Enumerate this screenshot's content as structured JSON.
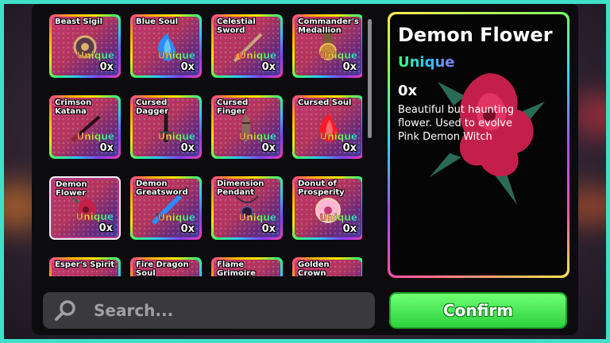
{
  "inventory": {
    "items": [
      {
        "name": "Beast Sigil",
        "rarity": "Unique",
        "qty": "0x",
        "icon": "beast-sigil-icon"
      },
      {
        "name": "Blue Soul",
        "rarity": "Unique",
        "qty": "0x",
        "icon": "blue-soul-icon"
      },
      {
        "name": "Celestial\nSword",
        "rarity": "Unique",
        "qty": "0x",
        "icon": "celestial-sword-icon"
      },
      {
        "name": "Commander's\nMedallion",
        "rarity": "Unique",
        "qty": "0x",
        "icon": "medallion-icon"
      },
      {
        "name": "Crimson\nKatana",
        "rarity": "Unique",
        "qty": "0x",
        "icon": "katana-icon"
      },
      {
        "name": "Cursed\nDagger",
        "rarity": "Unique",
        "qty": "0x",
        "icon": "dagger-icon"
      },
      {
        "name": "Cursed\nFinger",
        "rarity": "Unique",
        "qty": "0x",
        "icon": "finger-icon"
      },
      {
        "name": "Cursed Soul",
        "rarity": "Unique",
        "qty": "0x",
        "icon": "red-soul-icon"
      },
      {
        "name": "Demon\nFlower",
        "rarity": "Unique",
        "qty": "0x",
        "icon": "demon-flower-icon"
      },
      {
        "name": "Demon\nGreatsword",
        "rarity": "Unique",
        "qty": "0x",
        "icon": "greatsword-icon"
      },
      {
        "name": "Dimension\nPendant",
        "rarity": "Unique",
        "qty": "0x",
        "icon": "pendant-icon"
      },
      {
        "name": "Donut of\nProsperity",
        "rarity": "Unique",
        "qty": "0x",
        "icon": "donut-icon"
      },
      {
        "name": "Esper's Spirit",
        "rarity": "",
        "qty": "",
        "icon": "spirit-icon"
      },
      {
        "name": "Fire Dragon\nSoul",
        "rarity": "",
        "qty": "",
        "icon": "dragon-soul-icon"
      },
      {
        "name": "Flame\nGrimoire",
        "rarity": "",
        "qty": "",
        "icon": "grimoire-icon"
      },
      {
        "name": "Golden\nCrown",
        "rarity": "",
        "qty": "",
        "icon": "crown-icon"
      }
    ],
    "selected_index": 8
  },
  "detail": {
    "title": "Demon Flower",
    "rarity": "Unique",
    "qty": "0x",
    "description": "Beautiful but haunting flower. Used to evolve Pink Demon Witch"
  },
  "search": {
    "placeholder": "Search...",
    "value": ""
  },
  "confirm_label": "Confirm",
  "colors": {
    "accent_frame": "#3fe0c8",
    "confirm_green": "#3fdc48",
    "card_pink": "#c2366f"
  }
}
